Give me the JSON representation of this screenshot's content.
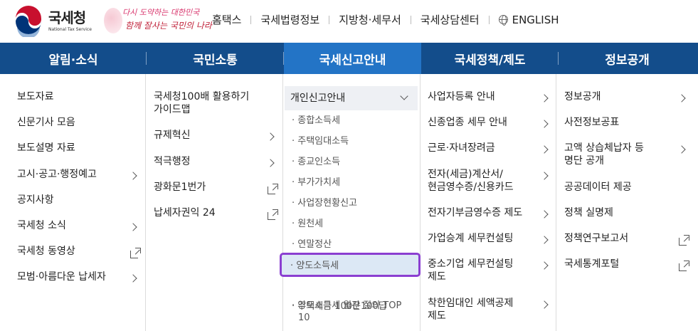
{
  "header": {
    "logo_kr": "국세청",
    "logo_en": "National Tax Service",
    "slogan_line1": "다시 도약하는 대한민국",
    "slogan_line2": "함께 잘사는 국민의 나라",
    "utils": [
      "홈택스",
      "국세법령정보",
      "지방청·세무서",
      "국세상담센터",
      "ENGLISH"
    ]
  },
  "nav": [
    "알림·소식",
    "국민소통",
    "국세신고안내",
    "국세정책/제도",
    "정보공개"
  ],
  "nav_active": 2,
  "menu": {
    "col1": [
      "보도자료",
      "신문기사 모음",
      "보도설명 자료",
      "고시·공고·행정예고",
      "공지사항",
      "국세청 소식",
      "국세청 동영상",
      "모범·아름다운 납세자"
    ],
    "col2": [
      "국세청100배 활용하기",
      "가이드맵",
      "규제혁신",
      "적극행정",
      "광화문1번가",
      "납세자권익 24"
    ],
    "col3_header": "개인신고안내",
    "col3": [
      "· 종합소득세",
      "· 주택임대소득",
      "· 종교인소득",
      "· 부가가치세",
      "· 사업장현황신고",
      "· 원천세",
      "· 연말정산",
      "· 양도소득세",
      "· 주택세금 100문100답",
      "· 양도소득세 월간 질의 TOP",
      "10"
    ],
    "col4": [
      "사업자등록 안내",
      "신종업종 세무 안내",
      "근로·자녀장려금",
      "전자(세금)계산서/",
      "현금영수증/신용카드",
      "전자기부금영수증 제도",
      "가업승계 세무컨설팅",
      "중소기업 세무컨설팅",
      "제도",
      "착한임대인 세액공제",
      "제도"
    ],
    "col5": [
      "정보공개",
      "사전정보공표",
      "고액 상습체납자 등",
      "명단 공개",
      "공공데이터 제공",
      "정책 실명제",
      "정책연구보고서",
      "국세통계포털"
    ]
  },
  "colors": {
    "nav_bg": "#134d8b",
    "nav_active": "#2374c6",
    "highlight_border": "#8b3fd1"
  }
}
